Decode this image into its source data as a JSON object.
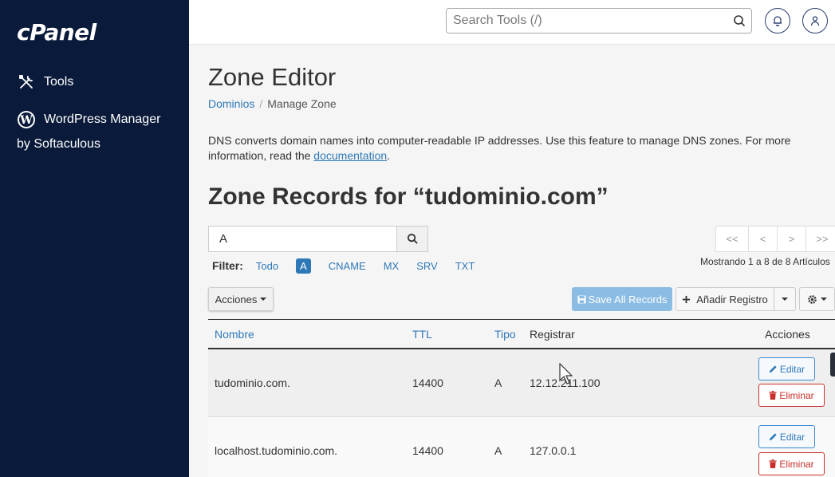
{
  "brand": {
    "logo_text": "cPanel"
  },
  "sidebar": {
    "items": [
      {
        "label": "Tools",
        "icon": "tools-icon"
      },
      {
        "label": "WordPress Manager",
        "sublabel": "by Softaculous",
        "icon": "wordpress-icon"
      }
    ]
  },
  "topbar": {
    "search_placeholder": "Search Tools (/)",
    "icons": [
      "search-icon",
      "bell-icon",
      "user-icon"
    ]
  },
  "page": {
    "title": "Zone Editor",
    "breadcrumb": {
      "parent": "Dominios",
      "sep": "/",
      "current": "Manage Zone"
    },
    "description_text": "DNS converts domain names into computer-readable IP addresses. Use this feature to manage DNS zones. For more information, read the ",
    "description_link": "documentation",
    "description_end": ".",
    "zone_title": "Zone Records for “tudominio.com”"
  },
  "filter": {
    "input_value": "A",
    "label": "Filter:",
    "options": [
      "Todo",
      "A",
      "CNAME",
      "MX",
      "SRV",
      "TXT"
    ],
    "active": "A"
  },
  "pager": {
    "buttons": [
      "<<",
      "<",
      ">",
      ">>"
    ],
    "showing": "Mostrando 1 a 8 de 8 Artículos"
  },
  "toolbar": {
    "acciones": "Acciones",
    "save_all": "Save All Records",
    "add_record": "Añadir Registro"
  },
  "table": {
    "headers": {
      "name": "Nombre",
      "ttl": "TTL",
      "type": "Tipo",
      "record": "Registrar",
      "actions": "Acciones"
    },
    "edit_label": "Editar",
    "delete_label": "Eliminar",
    "rows": [
      {
        "name": "tudominio.com.",
        "ttl": "14400",
        "type": "A",
        "record": "12.12.211.100"
      },
      {
        "name": "localhost.tudominio.com.",
        "ttl": "14400",
        "type": "A",
        "record": "127.0.0.1"
      }
    ]
  },
  "colors": {
    "sidebar": "#0a1a3a",
    "link": "#2f78b7",
    "danger": "#c9302c",
    "save": "#8bbce3"
  }
}
